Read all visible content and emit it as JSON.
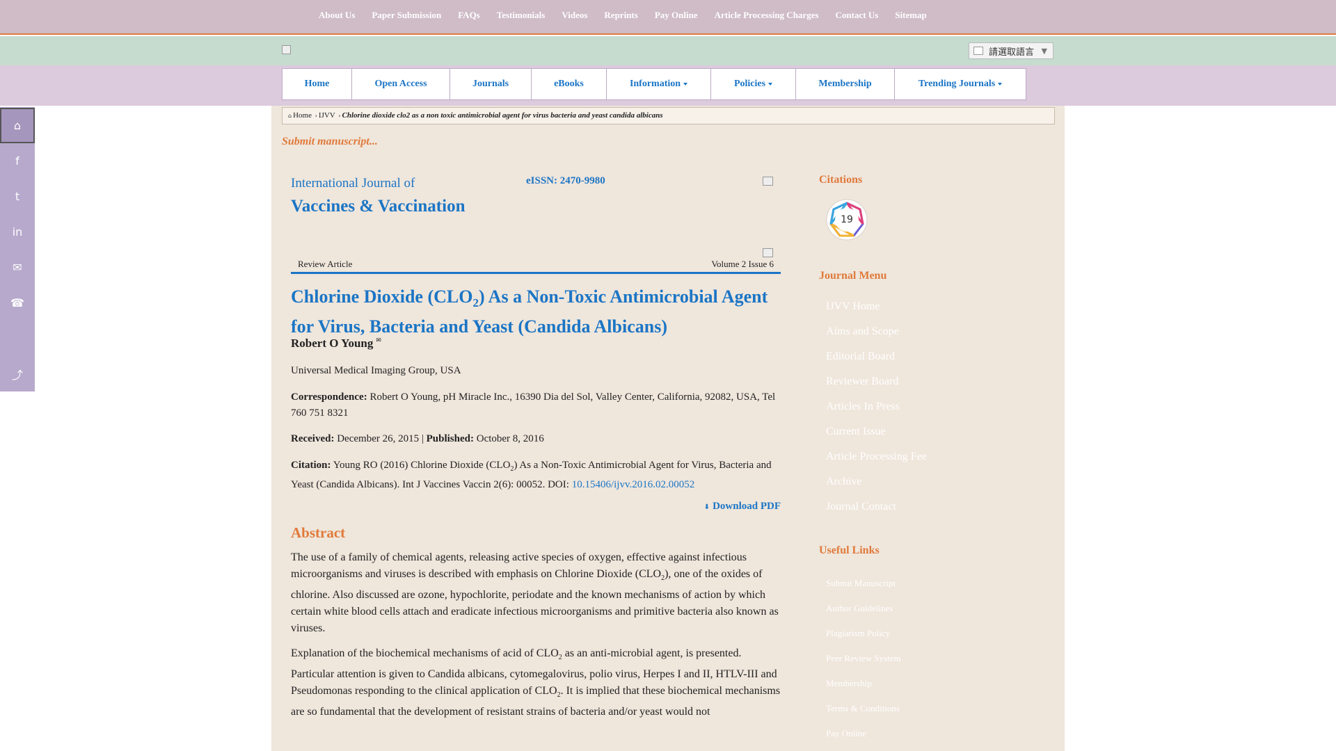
{
  "topnav": [
    "About Us",
    "Paper Submission",
    "FAQs",
    "Testimonials",
    "Videos",
    "Reprints",
    "Pay Online",
    "Article Processing Charges",
    "Contact Us",
    "Sitemap"
  ],
  "language": {
    "label": "請選取語言",
    "caret": "▼"
  },
  "mainnav": [
    {
      "label": "Home",
      "dropdown": false
    },
    {
      "label": "Open Access",
      "dropdown": false
    },
    {
      "label": "Journals",
      "dropdown": false
    },
    {
      "label": "eBooks",
      "dropdown": false
    },
    {
      "label": "Information",
      "dropdown": true
    },
    {
      "label": "Policies",
      "dropdown": true
    },
    {
      "label": "Membership",
      "dropdown": false
    },
    {
      "label": "Trending Journals",
      "dropdown": true
    }
  ],
  "sidebar_icons": [
    "home-icon",
    "facebook-icon",
    "twitter-icon",
    "linkedin-icon",
    "mail-icon",
    "phone-icon",
    "share-icon"
  ],
  "breadcrumb": {
    "home": "Home",
    "journal": "IJVV",
    "current": "Chlorine dioxide clo2 as a non toxic antimicrobial agent for virus bacteria and yeast candida albicans"
  },
  "submit_link": "Submit manuscript...",
  "journal": {
    "line1": "International Journal of",
    "line2": "Vaccines & Vaccination",
    "eissn": "eISSN: 2470-9980"
  },
  "article": {
    "type": "Review Article",
    "volume": "Volume 2 Issue 6",
    "title_part1": "Chlorine Dioxide (CLO",
    "title_sub": "2",
    "title_part2": ") As a Non-Toxic Antimicrobial Agent for Virus, Bacteria and Yeast (Candida Albicans)",
    "author": "Robert O Young",
    "affiliation": "Universal Medical Imaging Group, USA",
    "correspondence_label": "Correspondence:",
    "correspondence": "Robert O Young, pH Miracle Inc., 16390 Dia del Sol, Valley Center, California, 92082, USA, Tel 760 751 8321",
    "received_label": "Received:",
    "received": "December 26, 2015",
    "published_label": "Published:",
    "published": "October 8, 2016",
    "separator": "|",
    "citation_label": "Citation:",
    "citation_part1": "Young RO (2016) Chlorine Dioxide (CLO",
    "citation_sub": "2",
    "citation_part2": ") As a Non-Toxic Antimicrobial Agent for Virus, Bacteria and Yeast (Candida Albicans). Int J Vaccines Vaccin 2(6): 00052. DOI:",
    "doi": "10.15406/ijvv.2016.02.00052",
    "download": "Download PDF",
    "abstract_heading": "Abstract",
    "abs1_a": "The use of a family of chemical agents, releasing active species of oxygen, effective against infectious microorganisms and viruses is described with emphasis on Chlorine Dioxide (CLO",
    "abs1_sub": "2",
    "abs1_b": "), one of the oxides of chlorine. Also discussed are ozone, hypochlorite, periodate and the known mechanisms of action by which certain white blood cells attach and eradicate infectious microorganisms and primitive bacteria also known as viruses.",
    "abs2_a": "Explanation of the biochemical mechanisms of acid of CLO",
    "abs2_sub1": "2",
    "abs2_b": " as an anti-microbial agent, is presented. Particular attention is given to Candida albicans, cytomegalovirus, polio virus, Herpes I and II, HTLV-III and Pseudomonas responding to the clinical application of CLO",
    "abs2_sub2": "2",
    "abs2_c": ". It is implied that these biochemical mechanisms are so fundamental that the development of resistant strains of bacteria and/or yeast would not"
  },
  "right": {
    "citations_heading": "Citations",
    "citations_count": "19",
    "journal_menu_heading": "Journal Menu",
    "journal_menu": [
      "IJVV Home",
      "Aims and Scope",
      "Editorial Board",
      "Reviewer Board",
      "Articles In Press",
      "Current Issue",
      "Article Processing Fee",
      "Archive",
      "Journal Contact"
    ],
    "useful_links_heading": "Useful Links",
    "useful_links": [
      "Submit Manuscript",
      "Author Guidelines",
      "Plagiarism Policy",
      "Peer Review System",
      "Membership",
      "Terms & Conditions",
      "Pay Online"
    ]
  },
  "colors": {
    "accent_blue": "#1b75c5",
    "accent_orange": "#e07a3a",
    "topbar": "#cfbcc7",
    "greenbar": "#c5dccf",
    "navbar": "#dccadd",
    "content_bg": "#efe6dc"
  }
}
